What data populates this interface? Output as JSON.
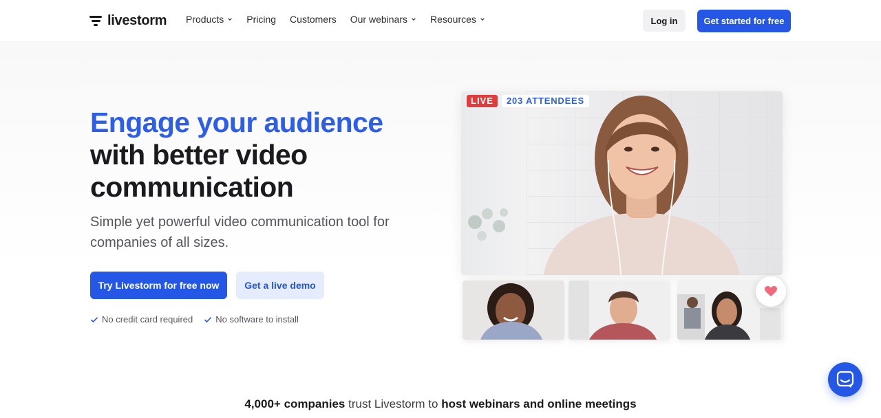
{
  "brand": {
    "name": "livestorm"
  },
  "nav": {
    "items": [
      {
        "label": "Products",
        "has_dropdown": true
      },
      {
        "label": "Pricing",
        "has_dropdown": false
      },
      {
        "label": "Customers",
        "has_dropdown": false
      },
      {
        "label": "Our webinars",
        "has_dropdown": true
      },
      {
        "label": "Resources",
        "has_dropdown": true
      }
    ],
    "login_label": "Log in",
    "cta_label": "Get started for free"
  },
  "hero": {
    "headline_highlight": "Engage your audience",
    "headline_line2": "with better video",
    "headline_line3": "communication",
    "subtitle": "Simple yet powerful video communication tool for companies of all sizes.",
    "primary_cta": "Try Livestorm for free now",
    "secondary_cta": "Get a live demo",
    "checks": [
      "No credit card required",
      "No software to install"
    ]
  },
  "video": {
    "live_label": "LIVE",
    "attendees_label": "203 ATTENDEES"
  },
  "trust": {
    "count": "4,000+ companies",
    "middle": " trust Livestorm to ",
    "end": "host webinars and online meetings"
  },
  "colors": {
    "accent": "#2457e6",
    "headline_blue": "#2d5ee8",
    "live_red": "#e23b3b",
    "heart_pink": "#f06b7a"
  },
  "icons": {
    "logo": "livestorm-logo-icon",
    "dropdown": "chevron-down-icon",
    "check": "check-icon",
    "reaction": "heart-icon",
    "chat": "chat-icon"
  }
}
